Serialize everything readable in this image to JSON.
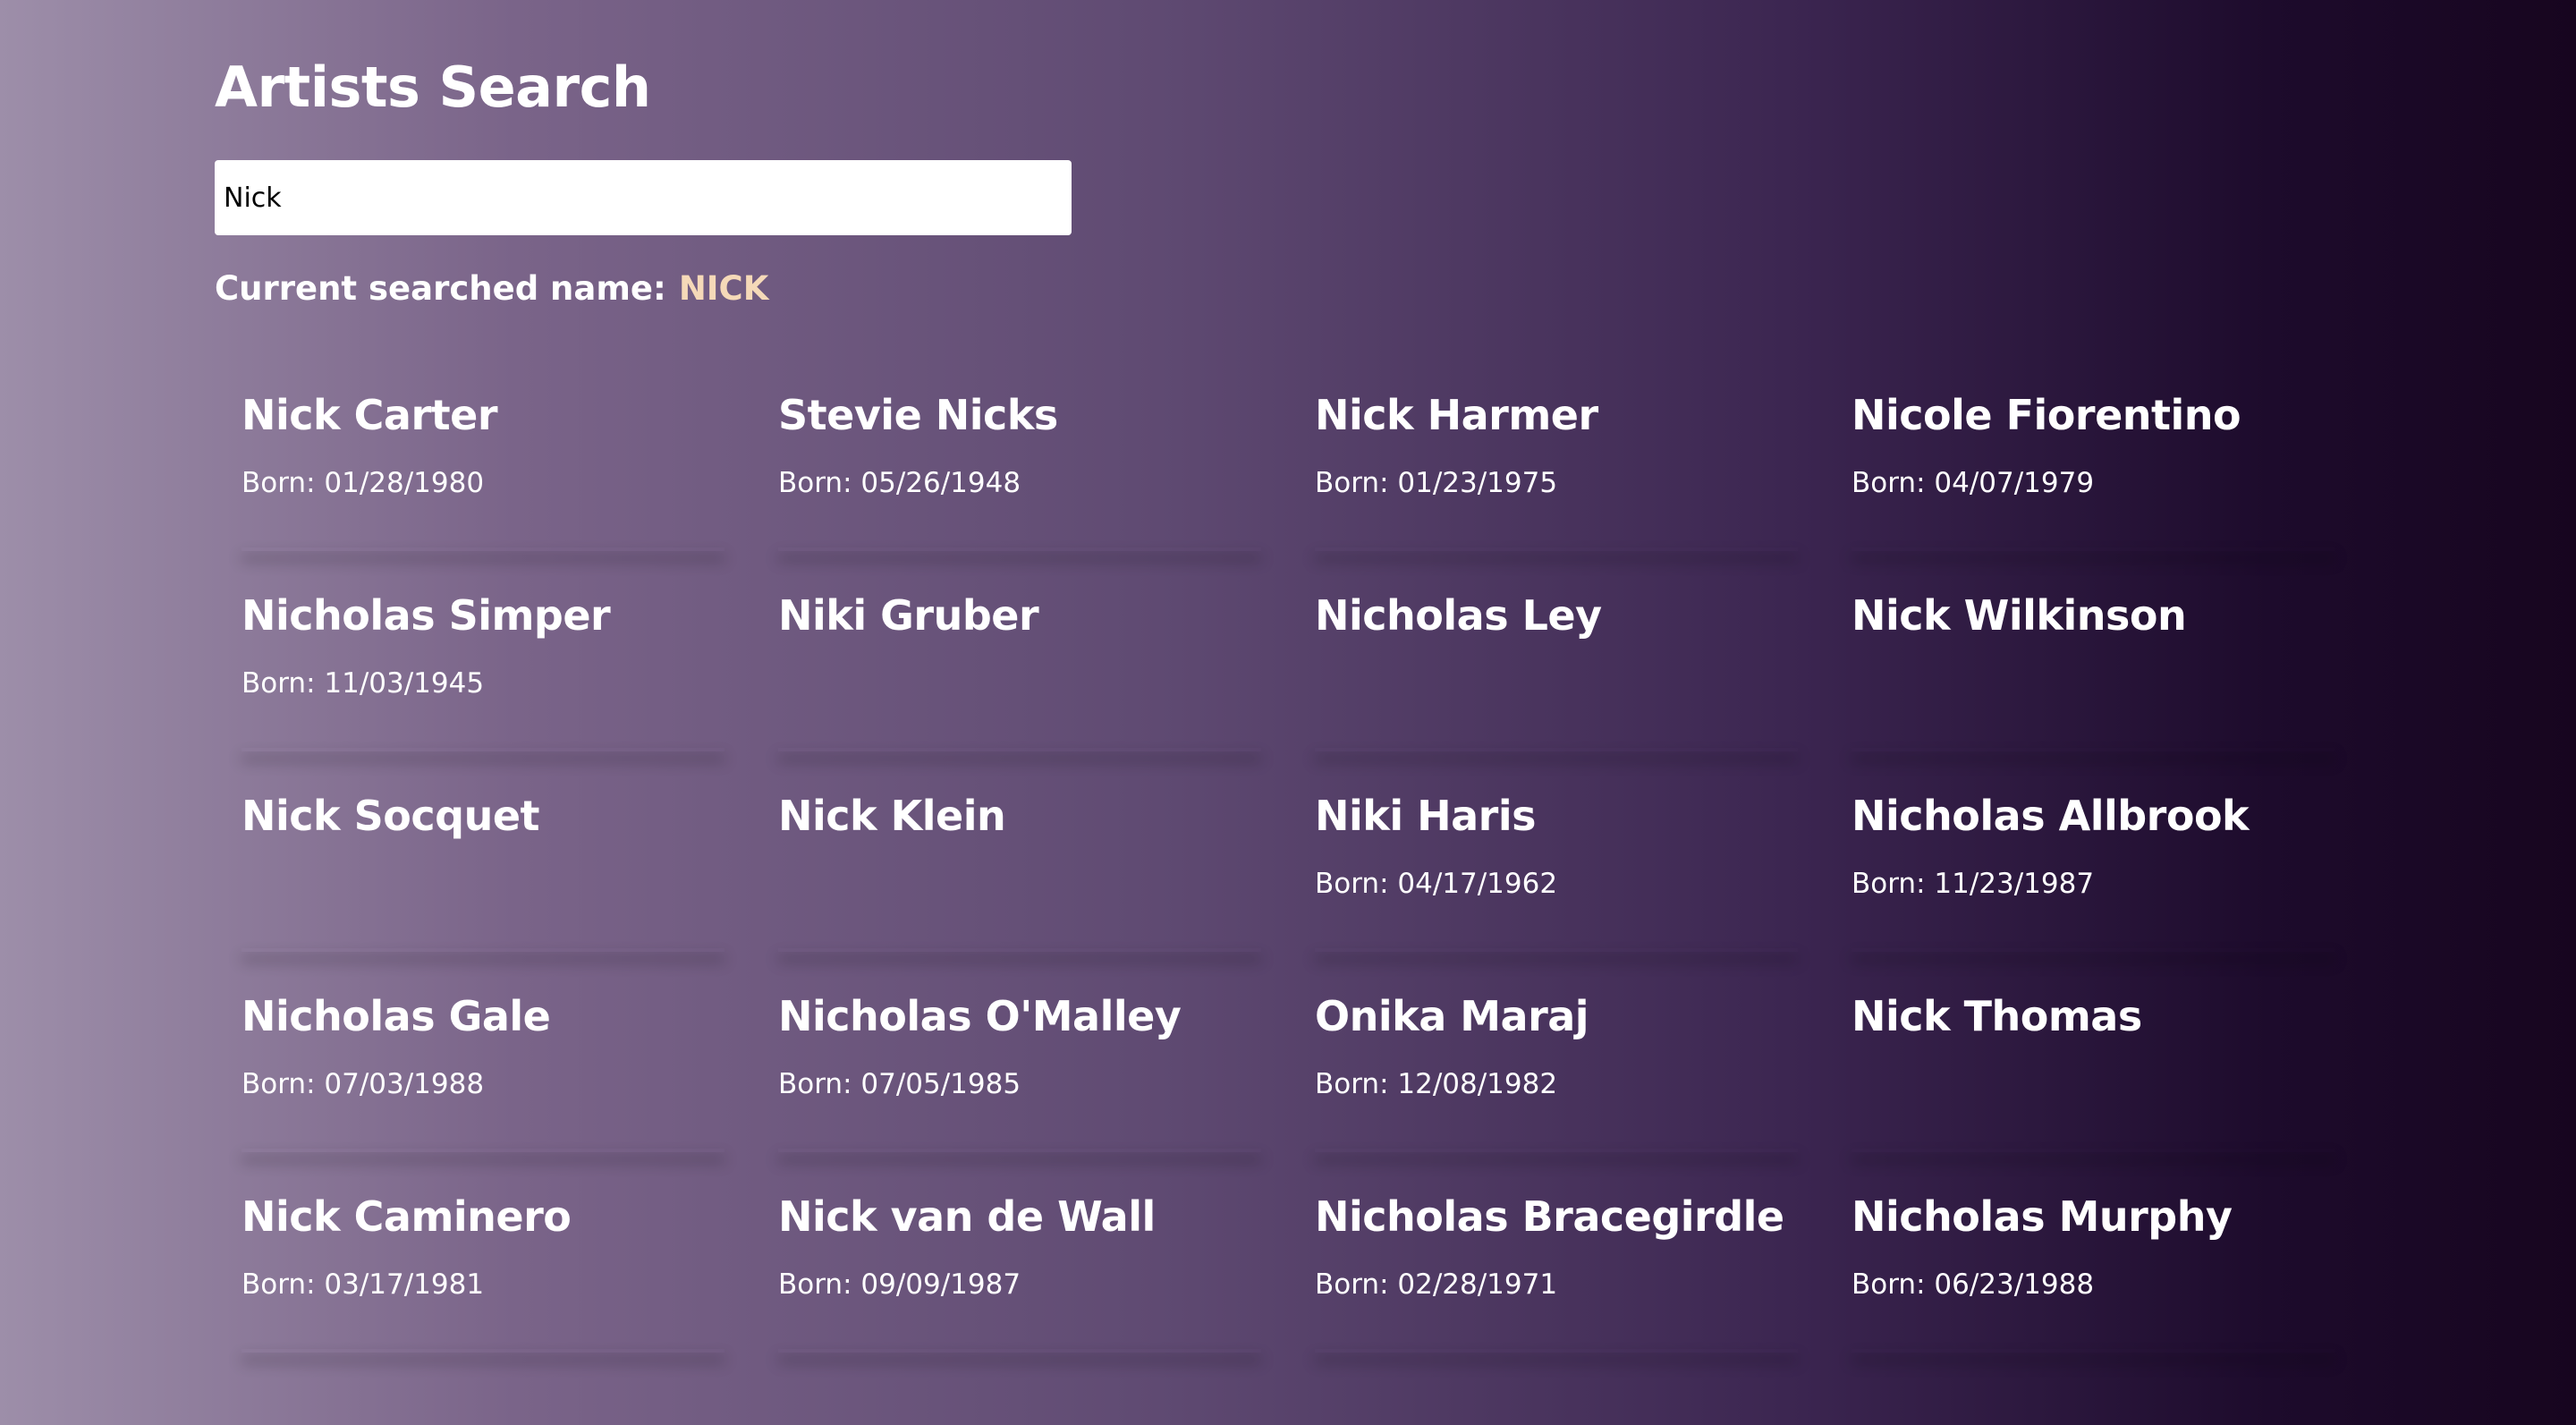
{
  "page": {
    "title": "Artists Search",
    "search": {
      "value": "Nick",
      "placeholder": ""
    },
    "current": {
      "label": "Current searched name:",
      "value": "NICK"
    }
  },
  "colors": {
    "accent": "#f5d9b8",
    "text": "#ffffff",
    "gradient_start": "#9d8ea9",
    "gradient_end": "#17051f"
  },
  "artists": [
    {
      "name": "Nick Carter",
      "born": "Born: 01/28/1980"
    },
    {
      "name": "Stevie Nicks",
      "born": "Born: 05/26/1948"
    },
    {
      "name": "Nick Harmer",
      "born": "Born: 01/23/1975"
    },
    {
      "name": "Nicole Fiorentino",
      "born": "Born: 04/07/1979"
    },
    {
      "name": "Nicholas Simper",
      "born": "Born: 11/03/1945"
    },
    {
      "name": "Niki Gruber",
      "born": ""
    },
    {
      "name": "Nicholas Ley",
      "born": ""
    },
    {
      "name": "Nick Wilkinson",
      "born": ""
    },
    {
      "name": "Nick Socquet",
      "born": ""
    },
    {
      "name": "Nick Klein",
      "born": ""
    },
    {
      "name": "Niki Haris",
      "born": "Born: 04/17/1962"
    },
    {
      "name": "Nicholas Allbrook",
      "born": "Born: 11/23/1987"
    },
    {
      "name": "Nicholas Gale",
      "born": "Born: 07/03/1988"
    },
    {
      "name": "Nicholas O'Malley",
      "born": "Born: 07/05/1985"
    },
    {
      "name": "Onika Maraj",
      "born": "Born: 12/08/1982"
    },
    {
      "name": "Nick Thomas",
      "born": ""
    },
    {
      "name": "Nick Caminero",
      "born": "Born: 03/17/1981"
    },
    {
      "name": "Nick van de Wall",
      "born": "Born: 09/09/1987"
    },
    {
      "name": "Nicholas Bracegirdle",
      "born": "Born: 02/28/1971"
    },
    {
      "name": "Nicholas Murphy",
      "born": "Born: 06/23/1988"
    }
  ]
}
